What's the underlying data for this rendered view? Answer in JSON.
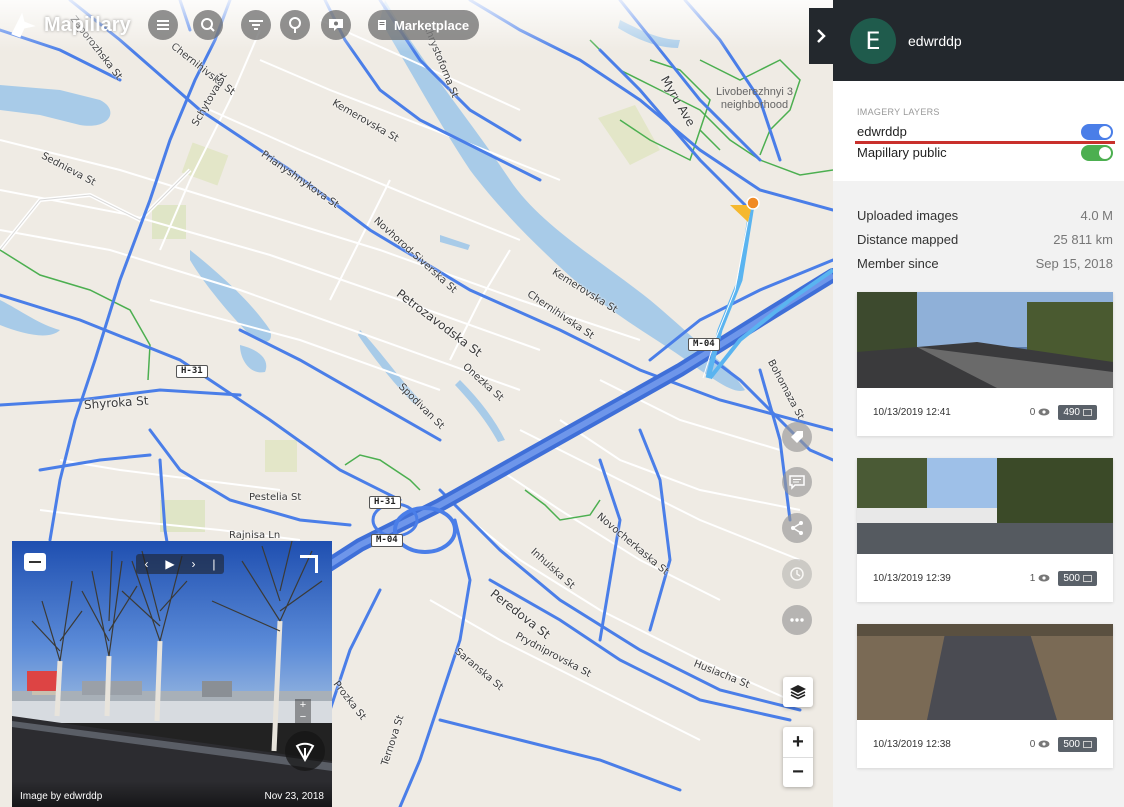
{
  "app": {
    "name": "Mapillary"
  },
  "toolbar": {
    "marketplace_label": "Marketplace"
  },
  "map": {
    "streets": [
      {
        "name": "Chernihivska St"
      },
      {
        "name": "Zaporozhska St"
      },
      {
        "name": "Schytova St"
      },
      {
        "name": "Kemerovska St"
      },
      {
        "name": "Sednieva St"
      },
      {
        "name": "Prianyshnykova St"
      },
      {
        "name": "Novhorod-Siverska St"
      },
      {
        "name": "Petrozavodska St"
      },
      {
        "name": "Kemerovska St"
      },
      {
        "name": "Chernihivska St"
      },
      {
        "name": "Onezka St"
      },
      {
        "name": "Spodivan St"
      },
      {
        "name": "Shyroka St"
      },
      {
        "name": "Pestelia St"
      },
      {
        "name": "Rajnisa Ln"
      },
      {
        "name": "Novocherkaska St"
      },
      {
        "name": "Inhulska St"
      },
      {
        "name": "Peredova St"
      },
      {
        "name": "Prydniprovska St"
      },
      {
        "name": "Saranska St"
      },
      {
        "name": "Husiacha St"
      },
      {
        "name": "Bohomaza St"
      },
      {
        "name": "Myru Ave"
      },
      {
        "name": "Prozka St"
      },
      {
        "name": "Ternova St"
      },
      {
        "name": "Khrystoforna St"
      }
    ],
    "shields": [
      {
        "label": "H-31"
      },
      {
        "label": "M-04"
      },
      {
        "label": "H-31"
      },
      {
        "label": "M-04"
      }
    ],
    "area_label": "Livoberezhnyi 3 neighborhood"
  },
  "viewer": {
    "credit": "Image by edwrddp",
    "date": "Nov 23, 2018",
    "nav_prev": "‹",
    "nav_play": "▶",
    "nav_next": "›",
    "nav_pipe": "|"
  },
  "sidebar": {
    "avatar_letter": "E",
    "username": "edwrddp",
    "imagery_layers_title": "IMAGERY LAYERS",
    "layers": [
      {
        "label": "edwrddp",
        "enabled": true,
        "color": "#4a7ee8"
      },
      {
        "label": "Mapillary public",
        "enabled": true,
        "color": "#4caf50"
      }
    ],
    "stats": [
      {
        "label": "Uploaded images",
        "value": "4.0 M"
      },
      {
        "label": "Distance mapped",
        "value": "25 811 km"
      },
      {
        "label": "Member since",
        "value": "Sep 15, 2018"
      }
    ],
    "sequences": [
      {
        "date": "10/13/2019 12:41",
        "views": "0",
        "count": "490"
      },
      {
        "date": "10/13/2019 12:39",
        "views": "1",
        "count": "500"
      },
      {
        "date": "10/13/2019 12:38",
        "views": "0",
        "count": "500"
      }
    ]
  },
  "colors": {
    "accent": "#4a7ee8",
    "header_bg": "#23282d",
    "water": "#a8cbe8",
    "green_trail": "#4caf50"
  }
}
